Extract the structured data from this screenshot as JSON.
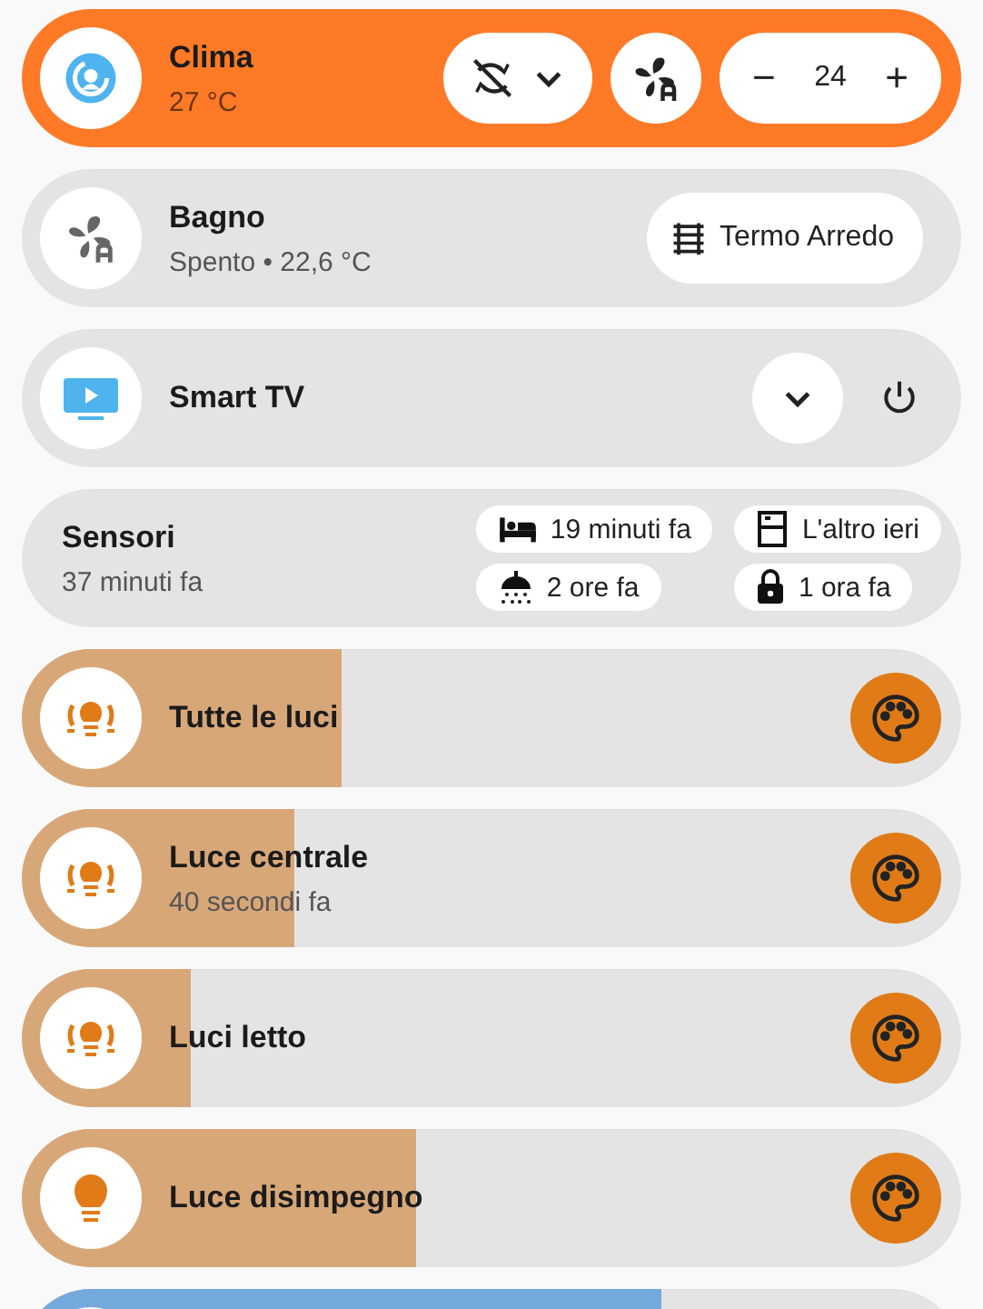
{
  "climate": {
    "name": "Clima",
    "state": "27 °C",
    "active": true,
    "minus": "−",
    "setpoint": "24",
    "plus": "+"
  },
  "devices": [
    {
      "kind": "fan",
      "name": "Bagno",
      "state": "Spento • 22,6 °C",
      "active": false,
      "button": "Termo Arredo"
    },
    {
      "kind": "tv",
      "name": "Smart TV",
      "active": false
    }
  ],
  "sensors": {
    "name": "Sensori",
    "state": "37 minuti fa",
    "chips": [
      "19 minuti fa",
      "L'altro ieri",
      "2 ore fa",
      "1 ora fa"
    ]
  },
  "lights": [
    {
      "kind": "group",
      "name": "Tutte le luci",
      "level": 0.34,
      "color": "#d8a778"
    },
    {
      "kind": "group",
      "name": "Luce centrale",
      "state": "40 secondi fa",
      "level": 0.29,
      "color": "#d8a778"
    },
    {
      "kind": "group",
      "name": "Luci letto",
      "level": 0.18,
      "color": "#d8a778"
    },
    {
      "kind": "single",
      "name": "Luce disimpegno",
      "level": 0.42,
      "color": "#d8a778"
    },
    {
      "level": 0.68,
      "color": "#74a9dc"
    }
  ]
}
